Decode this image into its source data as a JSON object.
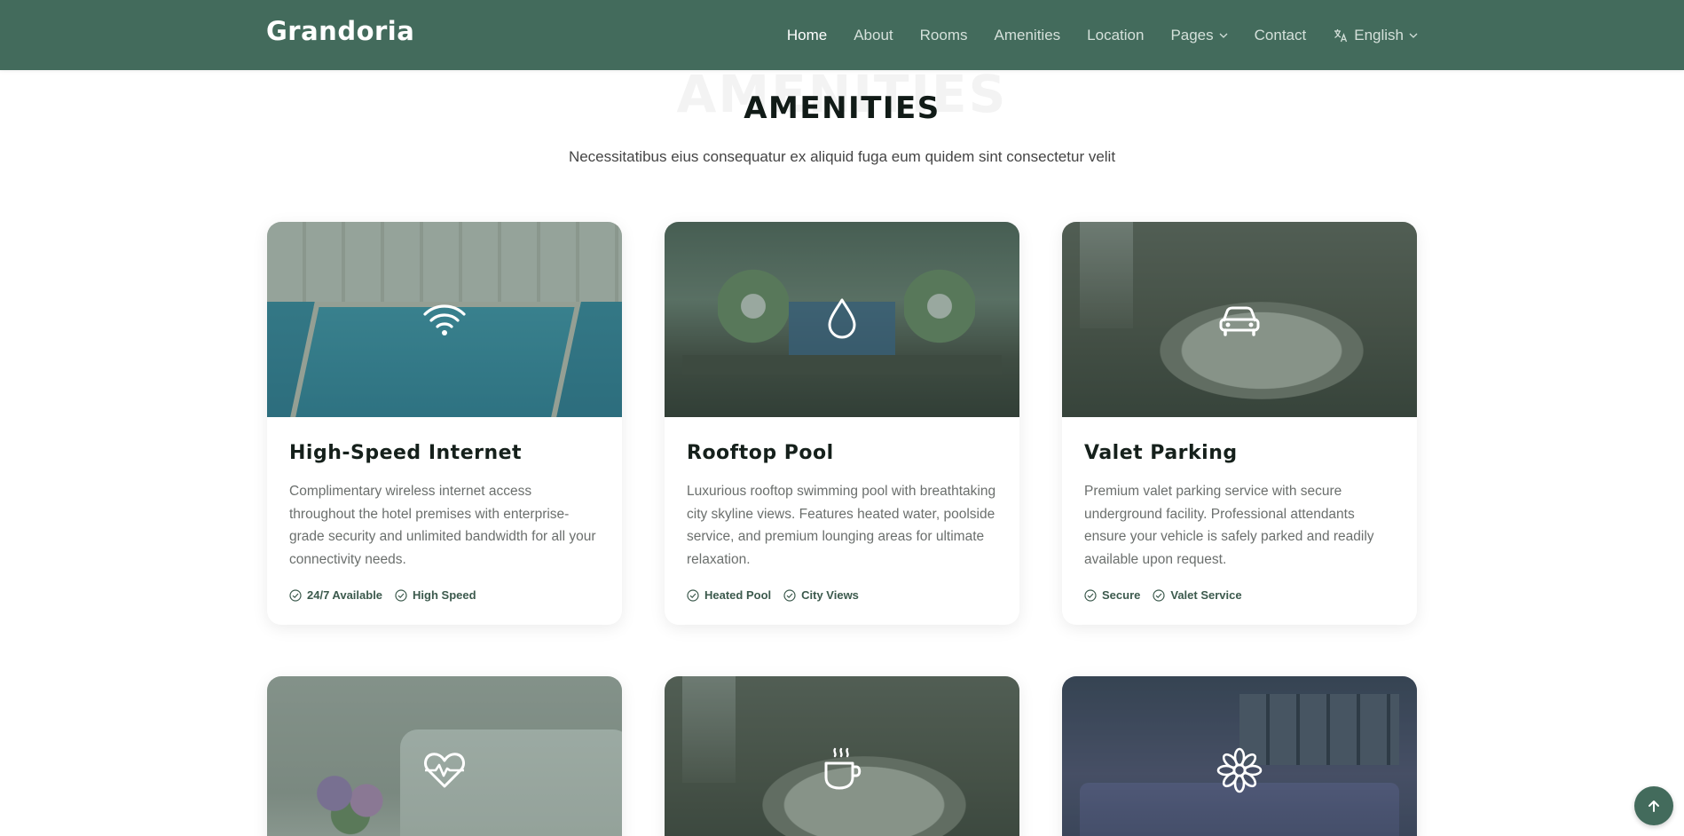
{
  "header": {
    "logo": "Grandoria",
    "nav": [
      {
        "label": "Home",
        "active": true
      },
      {
        "label": "About"
      },
      {
        "label": "Rooms"
      },
      {
        "label": "Amenities"
      },
      {
        "label": "Location"
      },
      {
        "label": "Pages",
        "dropdown": true
      },
      {
        "label": "Contact"
      }
    ],
    "language": {
      "label": "English",
      "icon": "translate-icon"
    }
  },
  "section": {
    "ghost_title": "AMENITIES",
    "title": "AMENITIES",
    "subtitle": "Necessitatibus eius consequatur ex aliquid fuga eum quidem sint consectetur velit"
  },
  "cards": [
    {
      "title": "High-Speed Internet",
      "icon": "wifi-icon",
      "description": "Complimentary wireless internet access throughout the hotel premises with enterprise-grade security and unlimited bandwidth for all your connectivity needs.",
      "tags": [
        "24/7 Available",
        "High Speed"
      ]
    },
    {
      "title": "Rooftop Pool",
      "icon": "water-drop-icon",
      "description": "Luxurious rooftop swimming pool with breathtaking city skyline views. Features heated water, poolside service, and premium lounging areas for ultimate relaxation.",
      "tags": [
        "Heated Pool",
        "City Views"
      ]
    },
    {
      "title": "Valet Parking",
      "icon": "car-icon",
      "description": "Premium valet parking service with secure underground facility. Professional attendants ensure your vehicle is safely parked and readily available upon request.",
      "tags": [
        "Secure",
        "Valet Service"
      ]
    },
    {
      "icon": "heart-pulse-icon"
    },
    {
      "icon": "coffee-cup-icon"
    },
    {
      "icon": "flower-icon"
    }
  ],
  "back_to_top": {
    "icon": "arrow-up-icon"
  },
  "colors": {
    "brand": "#436b5c",
    "heading": "#15201b",
    "tag": "#3c5a4d"
  }
}
